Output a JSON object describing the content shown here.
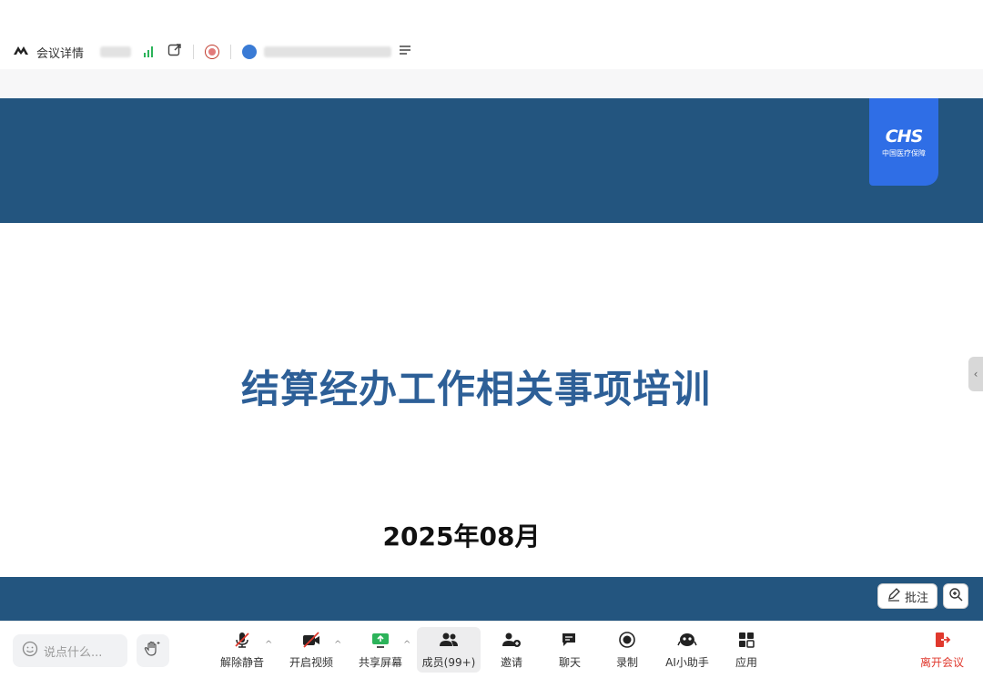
{
  "topbar": {
    "meeting_details": "会议详情"
  },
  "slide": {
    "logo_mark": "CHS",
    "logo_sub": "中国医疗保障",
    "title": "结算经办工作相关事项培训",
    "date": "2025年08月"
  },
  "stage": {
    "annotate_label": "批注"
  },
  "toolbar": {
    "chat_placeholder": "说点什么...",
    "unmute": "解除静音",
    "start_video": "开启视频",
    "share_screen": "共享屏幕",
    "members": "成员(99+)",
    "invite": "邀请",
    "chat": "聊天",
    "record": "录制",
    "ai_assistant": "AI小助手",
    "apps": "应用",
    "leave": "离开会议"
  },
  "colors": {
    "band": "#23557f",
    "title": "#2d5f97",
    "logo": "#2f6ee6",
    "leave": "#e0382d",
    "signal": "#2cb35a"
  }
}
